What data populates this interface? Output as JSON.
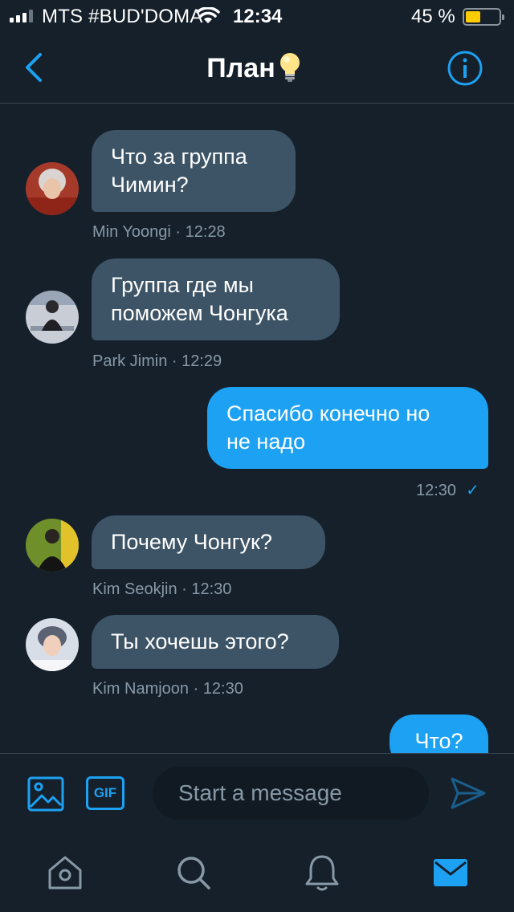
{
  "status_bar": {
    "carrier": "MTS #BUD'DOMA",
    "time": "12:34",
    "battery_percent": "45 %",
    "battery_level": 0.45
  },
  "header": {
    "title": "План",
    "title_emoji": "💡",
    "back_icon": "chevron-left-icon",
    "info_icon": "info-circle-icon"
  },
  "messages": [
    {
      "direction": "incoming",
      "text": "Что за группа\nЧимин?",
      "meta": "Min Yoongi · 12:28"
    },
    {
      "direction": "incoming",
      "text": "Группа где мы\nпоможем Чонгука",
      "meta": "Park Jimin · 12:29"
    },
    {
      "direction": "outgoing",
      "text": "Спасибо конечно но\nне надо",
      "meta": "12:30"
    },
    {
      "direction": "incoming",
      "text": "Почему Чонгук?",
      "meta": "Kim Seokjin · 12:30"
    },
    {
      "direction": "incoming",
      "text": "Ты хочешь этого?",
      "meta": "Kim Namjoon · 12:30"
    },
    {
      "direction": "outgoing",
      "text": "Что?"
    }
  ],
  "composer": {
    "placeholder": "Start a message",
    "gif_label": "GIF",
    "image_icon": "image-icon",
    "send_icon": "send-icon"
  },
  "tab_bar": {
    "items": [
      "home-icon",
      "search-icon",
      "bell-icon",
      "mail-icon"
    ],
    "active": "mail-icon"
  },
  "colors": {
    "background": "#15202b",
    "accent": "#1da1f2",
    "incoming_bubble": "#3d5466",
    "meta_text": "#8899a6"
  }
}
